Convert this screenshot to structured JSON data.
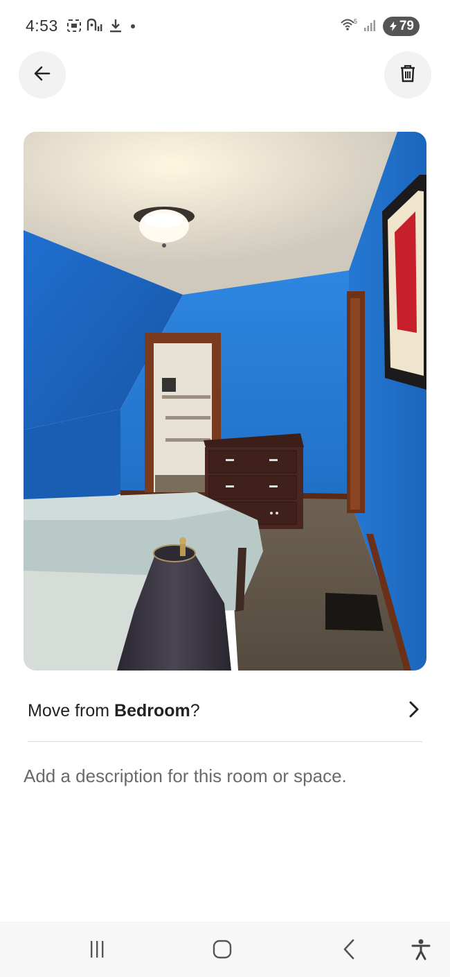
{
  "status_bar": {
    "time": "4:53",
    "battery": "79",
    "icons": [
      "screenshot-icon",
      "nfc-icon",
      "download-icon",
      "dot-icon",
      "wifi-icon",
      "signal-icon",
      "battery-icon"
    ]
  },
  "header": {
    "back_icon": "arrow-left-icon",
    "delete_icon": "trash-icon"
  },
  "photo": {
    "subject": "bedroom-photo"
  },
  "move": {
    "prefix": "Move from ",
    "room": "Bedroom",
    "suffix": "?"
  },
  "description": {
    "placeholder": "Add a description for this room or space."
  },
  "nav": {
    "icons": [
      "recents-icon",
      "home-icon",
      "back-icon",
      "accessibility-icon"
    ]
  }
}
